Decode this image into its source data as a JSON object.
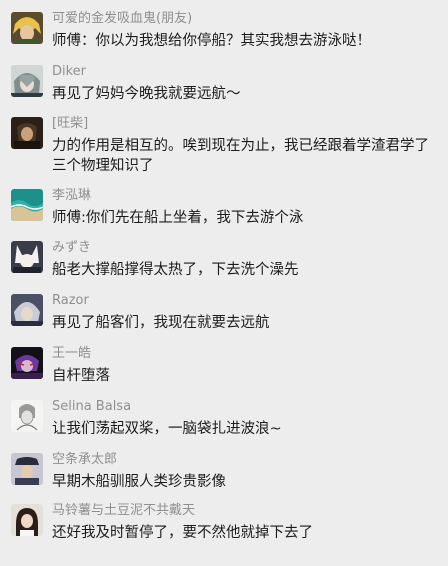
{
  "messages": [
    {
      "name": "可爱的金发吸血鬼(朋友)",
      "text": "师傅：你以为我想给你停船？其实我想去游泳哒！",
      "avatar": "blond-character-avatar"
    },
    {
      "name": "Diker",
      "text": "再见了妈妈今晚我就要远航～",
      "avatar": "grey-haired-character-avatar"
    },
    {
      "name": "[旺柴]",
      "text": "力的作用是相互的。唉到现在为止，我已经跟着学渣君学了三个物理知识了",
      "avatar": "dark-warrior-avatar"
    },
    {
      "name": "李泓琳",
      "text": "师傅:你们先在船上坐着，我下去游个泳",
      "avatar": "ocean-wave-avatar"
    },
    {
      "name": "みずき",
      "text": "船老大撑船撑得太热了，下去洗个澡先",
      "avatar": "white-fox-character-avatar"
    },
    {
      "name": "Razor",
      "text": "再见了船客们，我现在就要去远航",
      "avatar": "silver-haired-character-avatar"
    },
    {
      "name": "王一皓",
      "text": "自杆堕落",
      "avatar": "purple-character-avatar"
    },
    {
      "name": "Selina Balsa",
      "text": "让我们荡起双桨，一脑袋扎进波浪~",
      "avatar": "sketch-portrait-avatar"
    },
    {
      "name": "空条承太郎",
      "text": "早期木船驯服人类珍贵影像",
      "avatar": "jotaro-character-avatar"
    },
    {
      "name": "马铃薯与土豆泥不共戴天",
      "text": "还好我及时暂停了，要不然他就掉下去了",
      "avatar": "girl-photo-avatar"
    }
  ],
  "colors": {
    "background": "#ededed",
    "name": "#8f8f8f",
    "text": "#1c1c1c"
  }
}
